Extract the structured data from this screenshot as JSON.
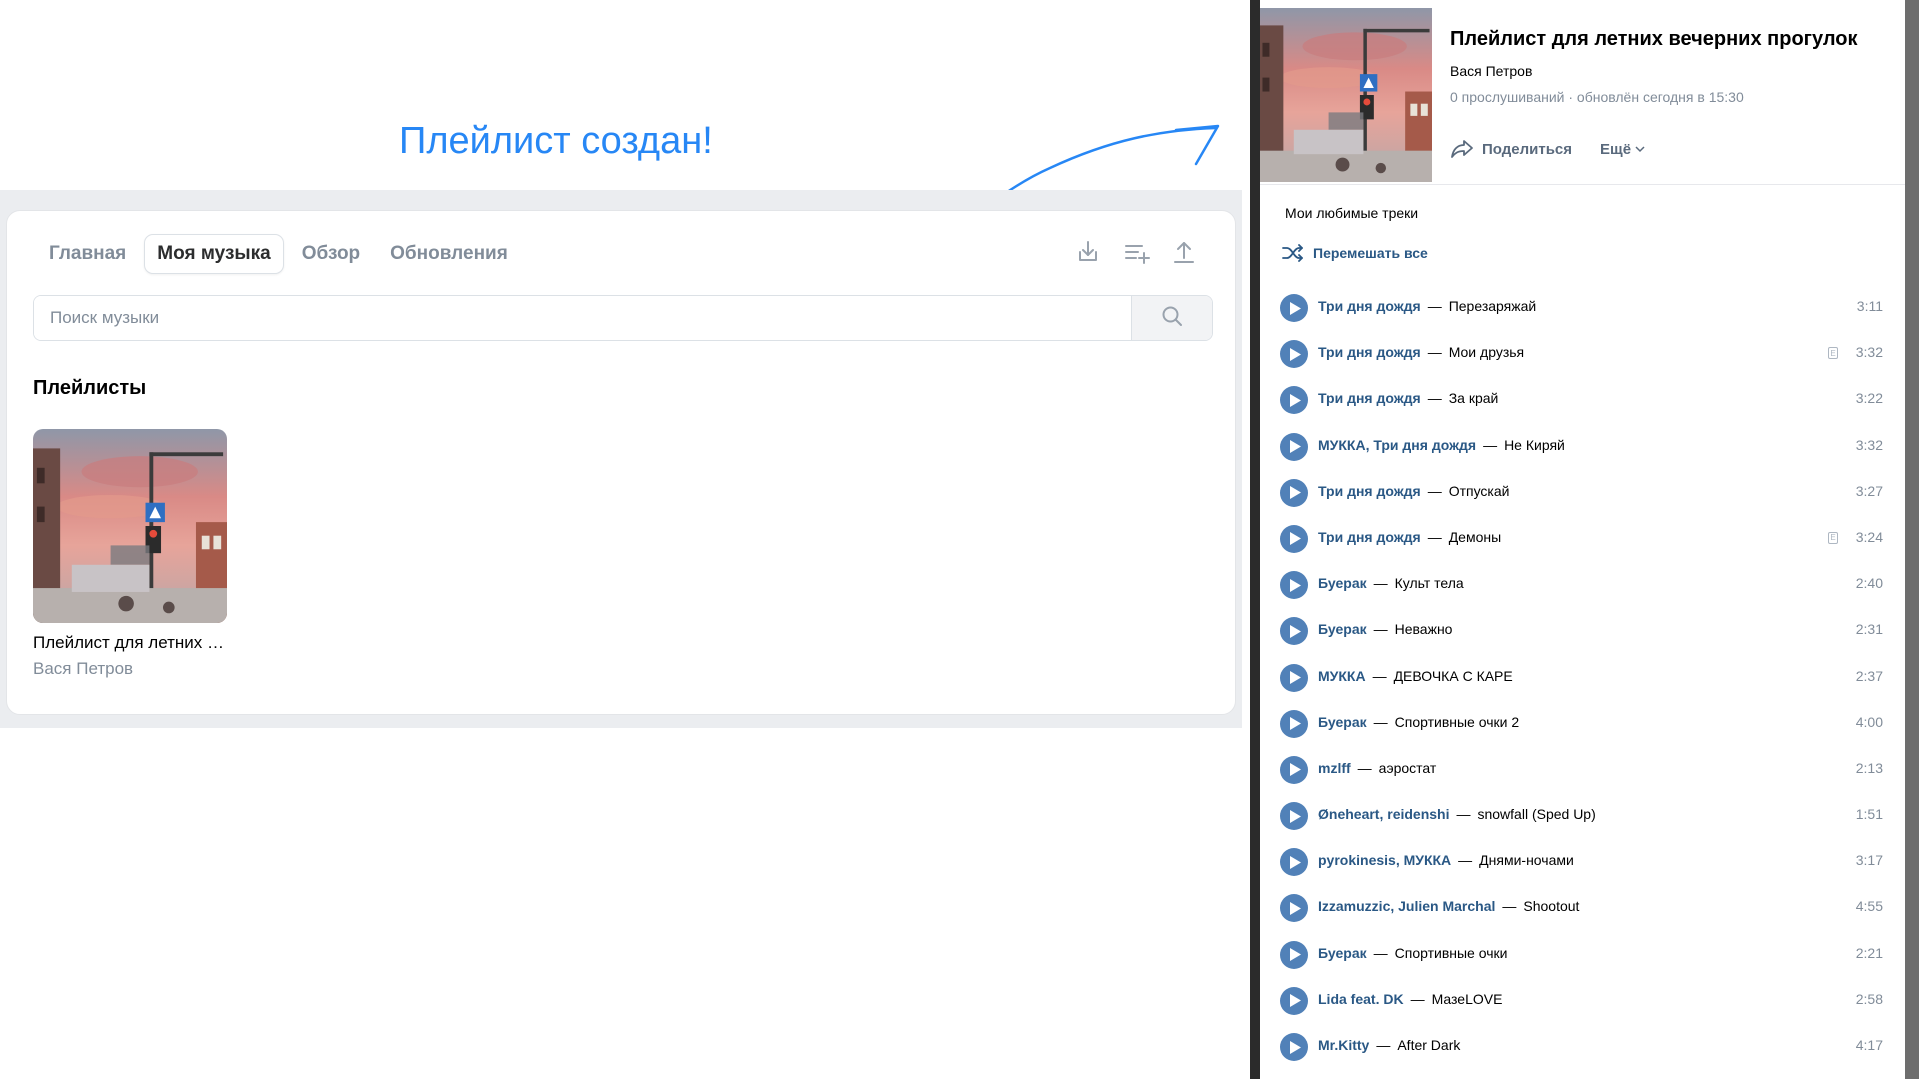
{
  "annotation": {
    "title": "Плейлист создан!"
  },
  "left": {
    "tabs": [
      {
        "label": "Главная",
        "active": false
      },
      {
        "label": "Моя музыка",
        "active": true
      },
      {
        "label": "Обзор",
        "active": false
      },
      {
        "label": "Обновления",
        "active": false
      }
    ],
    "toolbar_icons": [
      "download-icon",
      "add-playlist-icon",
      "upload-icon"
    ],
    "search": {
      "placeholder": "Поиск музыки",
      "value": ""
    },
    "section_title": "Плейлисты",
    "playlist_tile": {
      "title": "Плейлист для летних вечерних прогулок",
      "author": "Вася Петров"
    }
  },
  "right": {
    "title": "Плейлист для летних вечерних прогулок",
    "author": "Вася Петров",
    "meta": "0 прослушиваний · обновлён сегодня в 15:30",
    "share_label": "Поделиться",
    "more_label": "Ещё",
    "description": "Мои любимые треки",
    "shuffle_label": "Перемешать все",
    "tracks": [
      {
        "artist": "Три дня дождя",
        "song": "Перезаряжай",
        "duration": "3:11",
        "explicit": false
      },
      {
        "artist": "Три дня дождя",
        "song": "Мои друзья",
        "duration": "3:32",
        "explicit": true
      },
      {
        "artist": "Три дня дождя",
        "song": "За край",
        "duration": "3:22",
        "explicit": false
      },
      {
        "artist": "МУККА, Три дня дождя",
        "song": "Не Киряй",
        "duration": "3:32",
        "explicit": false
      },
      {
        "artist": "Три дня дождя",
        "song": "Отпускай",
        "duration": "3:27",
        "explicit": false
      },
      {
        "artist": "Три дня дождя",
        "song": "Демоны",
        "duration": "3:24",
        "explicit": true
      },
      {
        "artist": "Буерак",
        "song": "Культ тела",
        "duration": "2:40",
        "explicit": false
      },
      {
        "artist": "Буерак",
        "song": "Неважно",
        "duration": "2:31",
        "explicit": false
      },
      {
        "artist": "МУККА",
        "song": "ДЕВОЧКА С КАРЕ",
        "duration": "2:37",
        "explicit": false
      },
      {
        "artist": "Буерак",
        "song": "Спортивные очки 2",
        "duration": "4:00",
        "explicit": false
      },
      {
        "artist": "mzlff",
        "song": "аэростат",
        "duration": "2:13",
        "explicit": false
      },
      {
        "artist": "Øneheart, reidenshi",
        "song": "snowfall (Sped Up)",
        "duration": "1:51",
        "explicit": false
      },
      {
        "artist": "pyrokinesis, МУККА",
        "song": "Днями-ночами",
        "duration": "3:17",
        "explicit": false
      },
      {
        "artist": "Izzamuzzic, Julien Marchal",
        "song": "Shootout",
        "duration": "4:55",
        "explicit": false
      },
      {
        "artist": "Буерак",
        "song": "Спортивные очки",
        "duration": "2:21",
        "explicit": false
      },
      {
        "artist": "Lida feat. DK",
        "song": "МазеLOVE",
        "duration": "2:58",
        "explicit": false
      },
      {
        "artist": "Mr.Kitty",
        "song": "After Dark",
        "duration": "4:17",
        "explicit": false
      }
    ]
  },
  "colors": {
    "accent": "#2787f5",
    "link": "#2a5885",
    "play_button": "#5181b8",
    "muted": "#818c99"
  }
}
